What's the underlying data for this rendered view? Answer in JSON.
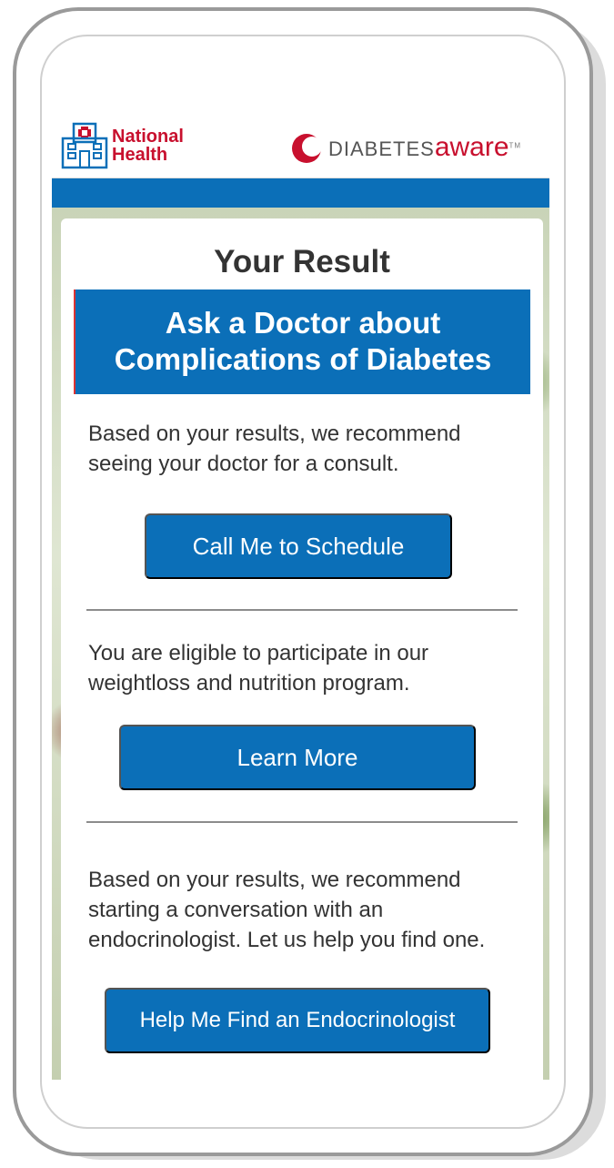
{
  "header": {
    "nh_name_line1": "National",
    "nh_name_line2": "Health",
    "da_brand_part1": "DIABETES",
    "da_brand_part2": "aware",
    "da_tm": "TM"
  },
  "result": {
    "title": "Your Result",
    "banner_line1": "Ask a Doctor about",
    "banner_line2": "Complications of Diabetes"
  },
  "sections": [
    {
      "text": "Based on your results, we recommend seeing your doctor for a consult.",
      "button": "Call Me to Schedule"
    },
    {
      "text": "You are eligible to participate in our weightloss and nutrition program.",
      "button": "Learn More"
    },
    {
      "text": "Based on your results, we recommend starting a conversation with an endocrinologist. Let us help you find one.",
      "button": "Help Me Find an Endocrinologist"
    }
  ],
  "colors": {
    "primary_blue": "#0b6fb8",
    "brand_red": "#c8102e",
    "text_dark": "#333333"
  }
}
